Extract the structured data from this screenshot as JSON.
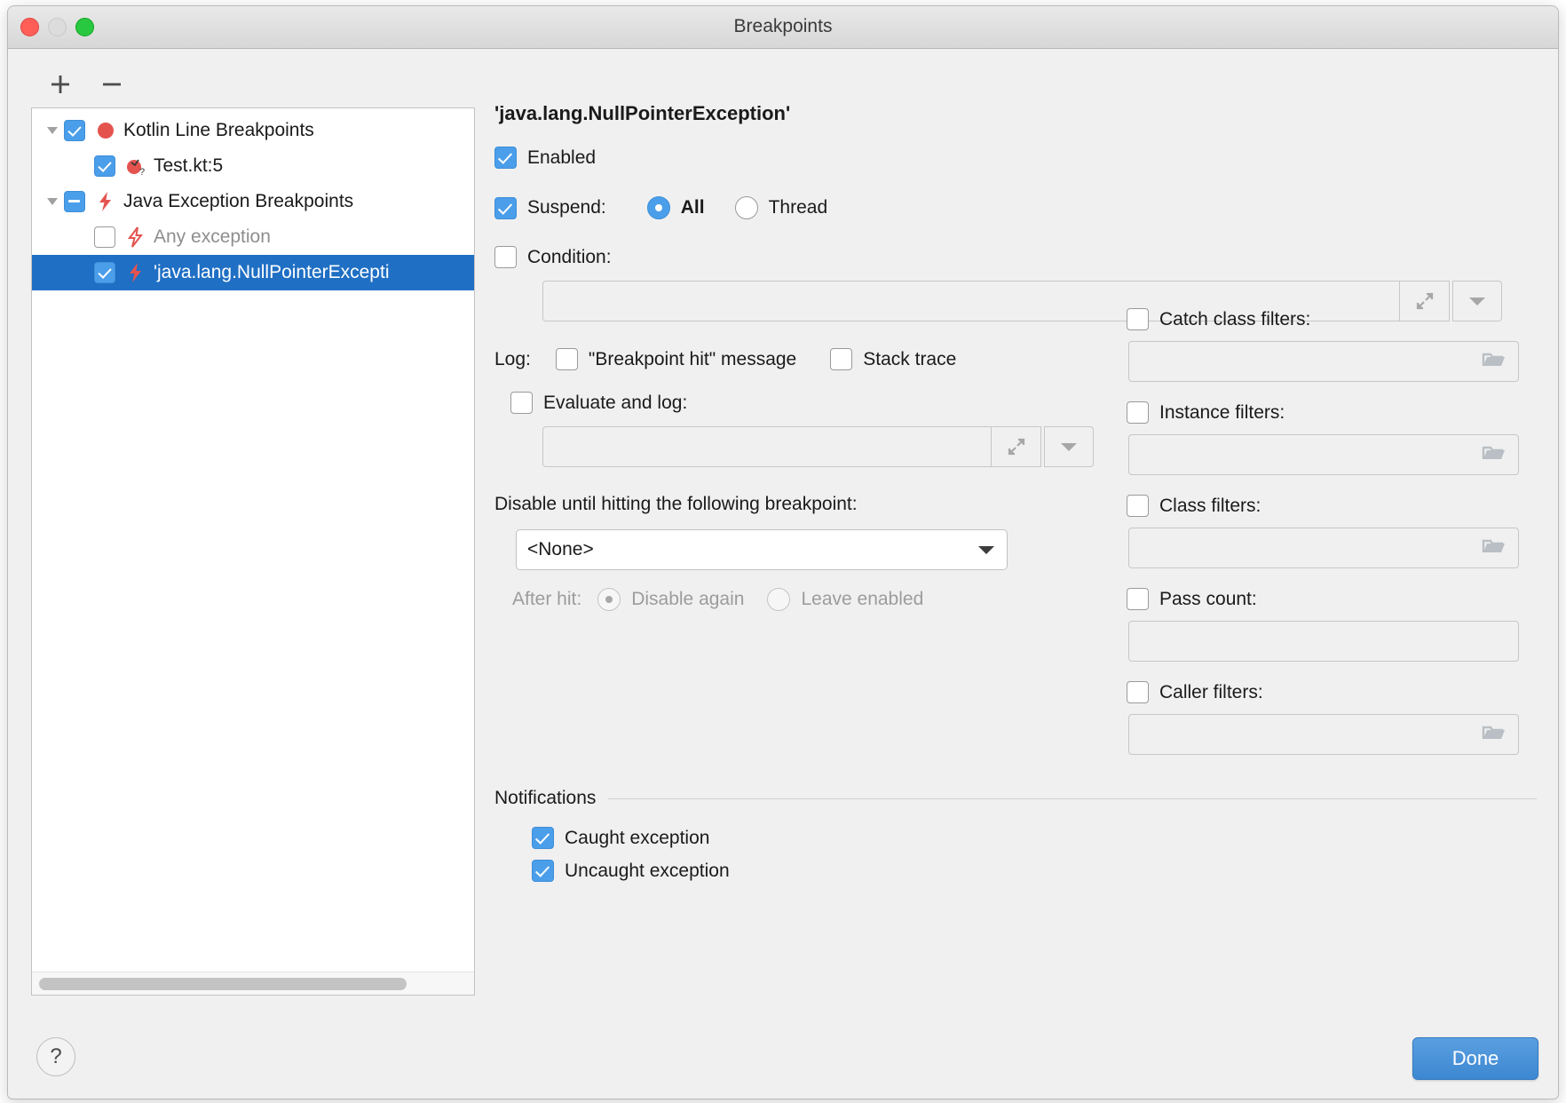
{
  "window": {
    "title": "Breakpoints",
    "traffic_lights": [
      "close",
      "minimize",
      "zoom"
    ]
  },
  "tree_toolbar": {
    "add_label": "+",
    "remove_label": "−"
  },
  "tree": {
    "items": [
      {
        "label": "Kotlin Line Breakpoints",
        "icon": "red-circle-breakpoint-icon",
        "checkbox": "checked",
        "twisty": "expanded",
        "depth": 0,
        "selected": false,
        "muted": false
      },
      {
        "label": "Test.kt:5",
        "icon": "kotlin-question-breakpoint-icon",
        "checkbox": "checked",
        "twisty": "none",
        "depth": 1,
        "selected": false,
        "muted": false
      },
      {
        "label": "Java Exception Breakpoints",
        "icon": "lightning-breakpoint-icon",
        "checkbox": "mixed",
        "twisty": "expanded",
        "depth": 0,
        "selected": false,
        "muted": false
      },
      {
        "label": "Any exception",
        "icon": "lightning-outline-icon",
        "checkbox": "unchecked",
        "twisty": "none",
        "depth": 1,
        "selected": false,
        "muted": true
      },
      {
        "label": "'java.lang.NullPointerExcepti",
        "icon": "lightning-breakpoint-icon",
        "checkbox": "checked",
        "twisty": "none",
        "depth": 1,
        "selected": true,
        "muted": false
      }
    ]
  },
  "details": {
    "title": "'java.lang.NullPointerException'",
    "enabled": {
      "label": "Enabled",
      "checked": true
    },
    "suspend": {
      "label": "Suspend:",
      "checked": true,
      "options": [
        "All",
        "Thread"
      ],
      "selected": "All"
    },
    "condition": {
      "label": "Condition:",
      "checked": false,
      "value": "",
      "expand_icon": "expand-arrows-icon",
      "dropdown_icon": "chevron-down-icon"
    },
    "log": {
      "label": "Log:",
      "message": {
        "label": "\"Breakpoint hit\" message",
        "checked": false
      },
      "stack_trace": {
        "label": "Stack trace",
        "checked": false
      },
      "evaluate": {
        "label": "Evaluate and log:",
        "checked": false,
        "value": "",
        "expand_icon": "expand-arrows-icon",
        "dropdown_icon": "chevron-down-icon"
      }
    },
    "disable_until": {
      "label": "Disable until hitting the following breakpoint:",
      "selected": "<None>",
      "options": [
        "<None>"
      ],
      "after_hit": {
        "label": "After hit:",
        "options": [
          "Disable again",
          "Leave enabled"
        ],
        "selected": "Disable again",
        "disabled": true
      }
    },
    "filters": [
      {
        "label": "Catch class filters:",
        "checked": false,
        "value": "",
        "browse_icon": "folder-icon"
      },
      {
        "label": "Instance filters:",
        "checked": false,
        "value": "",
        "browse_icon": "folder-icon"
      },
      {
        "label": "Class filters:",
        "checked": false,
        "value": "",
        "browse_icon": "folder-icon"
      },
      {
        "label": "Pass count:",
        "checked": false,
        "value": "",
        "browse_icon": "none"
      },
      {
        "label": "Caller filters:",
        "checked": false,
        "value": "",
        "browse_icon": "folder-icon"
      }
    ],
    "notifications": {
      "title": "Notifications",
      "items": [
        {
          "label": "Caught exception",
          "checked": true
        },
        {
          "label": "Uncaught exception",
          "checked": true
        }
      ]
    }
  },
  "footer": {
    "help_label": "?",
    "done_label": "Done"
  },
  "colors": {
    "accent": "#4a9eea",
    "selection": "#1f6fc4",
    "breakpoint_red": "#e5534f",
    "done_button": "#3d88d2"
  }
}
